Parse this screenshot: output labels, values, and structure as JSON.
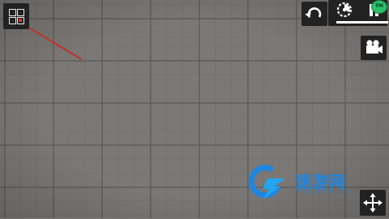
{
  "game": {
    "name": "",
    "background_color": "#7b7876",
    "grid_line_color": "#5a5856"
  },
  "menu_button": {
    "icon": "grid-menu-icon",
    "accent": "#e0302a"
  },
  "toolbar": {
    "undo_icon": "undo-icon",
    "slow_motion_icon": "slow-motion-icon",
    "pause_icon": "pause-icon",
    "badge_text": "TM",
    "badge_color": "#2bbf6a",
    "camera_icon": "camera-icon",
    "move_icon": "move-arrows-icon"
  },
  "watermark": {
    "logo_icon": "g-lightning-logo",
    "brand_text": "速游网",
    "url_text": "WWW.SUYOU.COM",
    "color": "#1f86e0"
  },
  "wire": {
    "color": "#c0322b"
  }
}
